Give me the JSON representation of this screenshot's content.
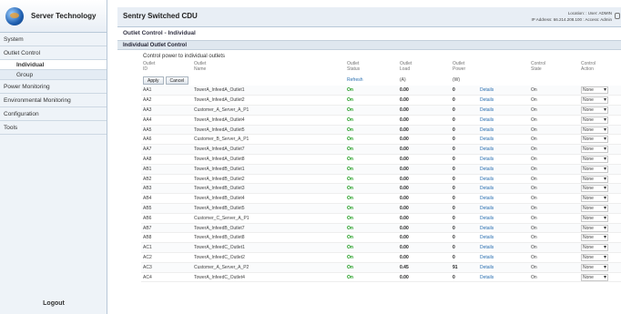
{
  "logo": {
    "text": "Server Technology"
  },
  "sidebar": {
    "items": [
      {
        "label": "System"
      },
      {
        "label": "Outlet Control",
        "children": [
          {
            "label": "Individual",
            "active": true
          },
          {
            "label": "Group"
          }
        ]
      },
      {
        "label": "Power Monitoring"
      },
      {
        "label": "Environmental Monitoring"
      },
      {
        "label": "Configuration"
      },
      {
        "label": "Tools"
      }
    ],
    "logout": "Logout"
  },
  "header": {
    "title": "Sentry Switched CDU",
    "info_line1": "Location:   :   User: ADMIN",
    "info_line2": "IP Address: 66.214.208.100  :  Access: Admin"
  },
  "breadcrumb": "Outlet Control - Individual",
  "section_title": "Individual Outlet Control",
  "subsection_title": "Control power to individual outlets",
  "columns": {
    "id": [
      "Outlet",
      "ID"
    ],
    "name": [
      "Outlet",
      "Name"
    ],
    "status": [
      "Outlet",
      "Status"
    ],
    "load": [
      "Outlet",
      "Load"
    ],
    "power": [
      "Outlet",
      "Power"
    ],
    "state": [
      "Control",
      "State"
    ],
    "action": [
      "Control",
      "Action"
    ]
  },
  "units": {
    "load": "(A)",
    "power": "(W)"
  },
  "buttons": {
    "apply": "Apply",
    "cancel": "Cancel",
    "refresh": "Refresh"
  },
  "details_label": "Details",
  "rows": [
    {
      "id": "AA1",
      "name": "TowerA_InfeedA_Outlet1",
      "status": "On",
      "load": "0.00",
      "power": "0",
      "state": "On",
      "action": "None"
    },
    {
      "id": "AA2",
      "name": "TowerA_InfeedA_Outlet2",
      "status": "On",
      "load": "0.00",
      "power": "0",
      "state": "On",
      "action": "None"
    },
    {
      "id": "AA3",
      "name": "Customer_A_Server_A_P1",
      "status": "On",
      "load": "0.00",
      "power": "0",
      "state": "On",
      "action": "None"
    },
    {
      "id": "AA4",
      "name": "TowerA_InfeedA_Outlet4",
      "status": "On",
      "load": "0.00",
      "power": "0",
      "state": "On",
      "action": "None"
    },
    {
      "id": "AA5",
      "name": "TowerA_InfeedA_Outlet5",
      "status": "On",
      "load": "0.00",
      "power": "0",
      "state": "On",
      "action": "None"
    },
    {
      "id": "AA6",
      "name": "Customer_B_Server_A_P1",
      "status": "On",
      "load": "0.00",
      "power": "0",
      "state": "On",
      "action": "None"
    },
    {
      "id": "AA7",
      "name": "TowerA_InfeedA_Outlet7",
      "status": "On",
      "load": "0.00",
      "power": "0",
      "state": "On",
      "action": "None"
    },
    {
      "id": "AA8",
      "name": "TowerA_InfeedA_Outlet8",
      "status": "On",
      "load": "0.00",
      "power": "0",
      "state": "On",
      "action": "None"
    },
    {
      "id": "AB1",
      "name": "TowerA_InfeedB_Outlet1",
      "status": "On",
      "load": "0.00",
      "power": "0",
      "state": "On",
      "action": "None"
    },
    {
      "id": "AB2",
      "name": "TowerA_InfeedB_Outlet2",
      "status": "On",
      "load": "0.00",
      "power": "0",
      "state": "On",
      "action": "None"
    },
    {
      "id": "AB3",
      "name": "TowerA_InfeedB_Outlet3",
      "status": "On",
      "load": "0.00",
      "power": "0",
      "state": "On",
      "action": "None"
    },
    {
      "id": "AB4",
      "name": "TowerA_InfeedB_Outlet4",
      "status": "On",
      "load": "0.00",
      "power": "0",
      "state": "On",
      "action": "None"
    },
    {
      "id": "AB5",
      "name": "TowerA_InfeedB_Outlet5",
      "status": "On",
      "load": "0.00",
      "power": "0",
      "state": "On",
      "action": "None"
    },
    {
      "id": "AB6",
      "name": "Customer_C_Server_A_P1",
      "status": "On",
      "load": "0.00",
      "power": "0",
      "state": "On",
      "action": "None"
    },
    {
      "id": "AB7",
      "name": "TowerA_InfeedB_Outlet7",
      "status": "On",
      "load": "0.00",
      "power": "0",
      "state": "On",
      "action": "None"
    },
    {
      "id": "AB8",
      "name": "TowerA_InfeedB_Outlet8",
      "status": "On",
      "load": "0.00",
      "power": "0",
      "state": "On",
      "action": "None"
    },
    {
      "id": "AC1",
      "name": "TowerA_InfeedC_Outlet1",
      "status": "On",
      "load": "0.00",
      "power": "0",
      "state": "On",
      "action": "None"
    },
    {
      "id": "AC2",
      "name": "TowerA_InfeedC_Outlet2",
      "status": "On",
      "load": "0.00",
      "power": "0",
      "state": "On",
      "action": "None"
    },
    {
      "id": "AC3",
      "name": "Customer_A_Server_A_P2",
      "status": "On",
      "load": "0.45",
      "power": "91",
      "state": "On",
      "action": "None"
    },
    {
      "id": "AC4",
      "name": "TowerA_InfeedC_Outlet4",
      "status": "On",
      "load": "0.00",
      "power": "0",
      "state": "On",
      "action": "None"
    }
  ],
  "colors": {
    "status_on": "#1a9a1a",
    "link": "#2a6fb0",
    "sidebar_bg": "#eef3f8"
  }
}
